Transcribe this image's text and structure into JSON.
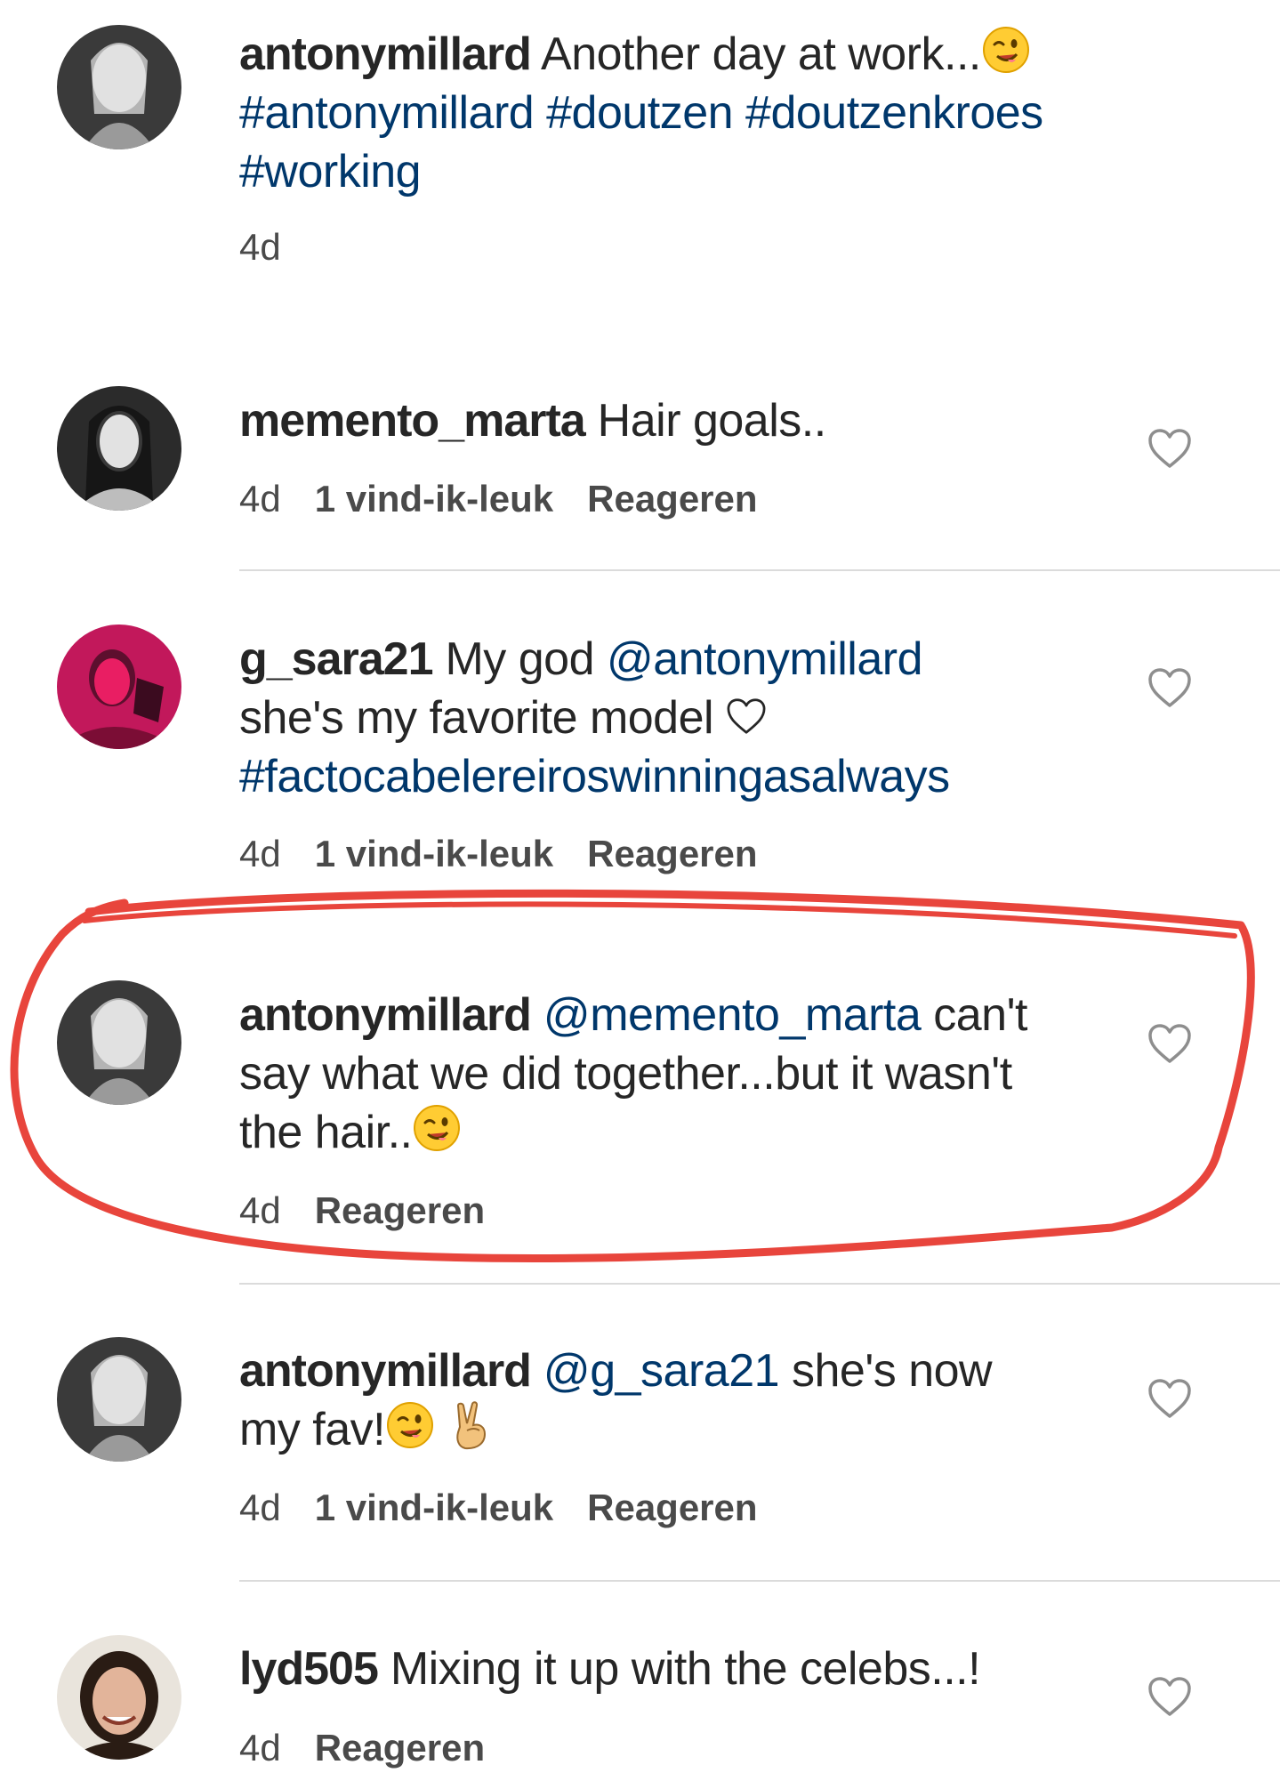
{
  "comments": [
    {
      "username": "antonymillard",
      "text": "Another day at work...",
      "hashtags_line1": "#antonymillard #doutzen #doutzenkroes",
      "hashtags_line2": "#working",
      "time": "4d"
    },
    {
      "username": "memento_marta",
      "text": "Hair goals..",
      "time": "4d",
      "likes": "1 vind-ik-leuk",
      "reply": "Reageren"
    },
    {
      "username": "g_sara21",
      "text1": "My god",
      "mention": "@antonymillard",
      "text2": "she's my favorite model",
      "hashtag": "#factocabelereiroswinningasalways",
      "time": "4d",
      "likes": "1 vind-ik-leuk",
      "reply": "Reageren"
    },
    {
      "username": "antonymillard",
      "mention": "@memento_marta",
      "text1": "can't",
      "text2": "say what we did together...but it wasn't",
      "text3": "the hair..",
      "time": "4d",
      "reply": "Reageren"
    },
    {
      "username": "antonymillard",
      "mention": "@g_sara21",
      "text1": "she's now",
      "text2": "my fav!",
      "time": "4d",
      "likes": "1 vind-ik-leuk",
      "reply": "Reageren"
    },
    {
      "username": "lyd505",
      "text": "Mixing it up with the celebs...!",
      "time": "4d",
      "reply": "Reageren"
    }
  ],
  "colors": {
    "hashtag": "#00376b",
    "annotation": "#e8453c"
  },
  "icons": [
    "like-heart-icon",
    "wink-emoji-icon",
    "victory-hand-emoji-icon"
  ]
}
